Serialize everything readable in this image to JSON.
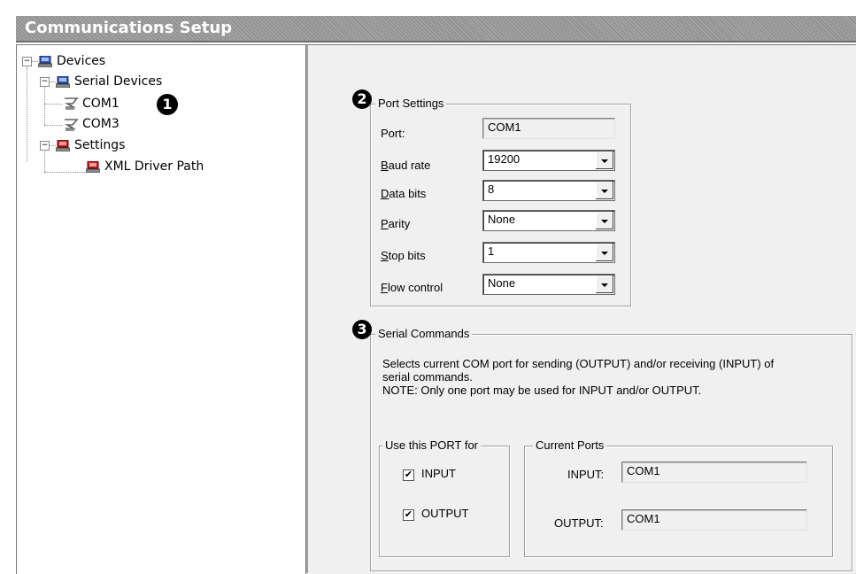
{
  "window": {
    "title": "Communications Setup"
  },
  "tree": {
    "root": {
      "label": "Devices",
      "expander": "−"
    },
    "serial_devices": {
      "label": "Serial Devices",
      "expander": "−"
    },
    "com1": {
      "label": "COM1"
    },
    "com3": {
      "label": "COM3"
    },
    "settings": {
      "label": "Settings",
      "expander": "−"
    },
    "xml_driver_path": {
      "label": "XML Driver Path"
    }
  },
  "markers": {
    "one": "1",
    "two": "2",
    "three": "3"
  },
  "port_settings": {
    "title": "Port Settings",
    "port": {
      "label": "Port:",
      "value": "COM1"
    },
    "baud_rate": {
      "label_first": "B",
      "label_rest": "aud rate",
      "value": "19200"
    },
    "data_bits": {
      "label_first": "D",
      "label_rest": "ata bits",
      "value": "8"
    },
    "parity": {
      "label_first": "P",
      "label_rest": "arity",
      "value": "None"
    },
    "stop_bits": {
      "label_first": "S",
      "label_rest": "top bits",
      "value": "1"
    },
    "flow_control": {
      "label_first": "F",
      "label_rest": "low control",
      "value": "None"
    }
  },
  "serial_commands": {
    "title": "Serial Commands",
    "description_line1": "Selects current COM port for sending (OUTPUT) and/or receiving (INPUT) of",
    "description_line2": "serial commands.",
    "note": "NOTE: Only one port may be used for INPUT and/or OUTPUT.",
    "use_port_for": {
      "title": "Use this PORT for",
      "input": {
        "label": "INPUT",
        "checked": true,
        "mark": "✔"
      },
      "output": {
        "label": "OUTPUT",
        "checked": true,
        "mark": "✔"
      }
    },
    "current_ports": {
      "title": "Current Ports",
      "input": {
        "label": "INPUT:",
        "value": "COM1"
      },
      "output": {
        "label": "OUTPUT:",
        "value": "COM1"
      }
    }
  },
  "colors": {
    "title_text": "#ffffff",
    "panel_bg": "#f0f0f0",
    "title_bar": "#9a9a9a"
  }
}
